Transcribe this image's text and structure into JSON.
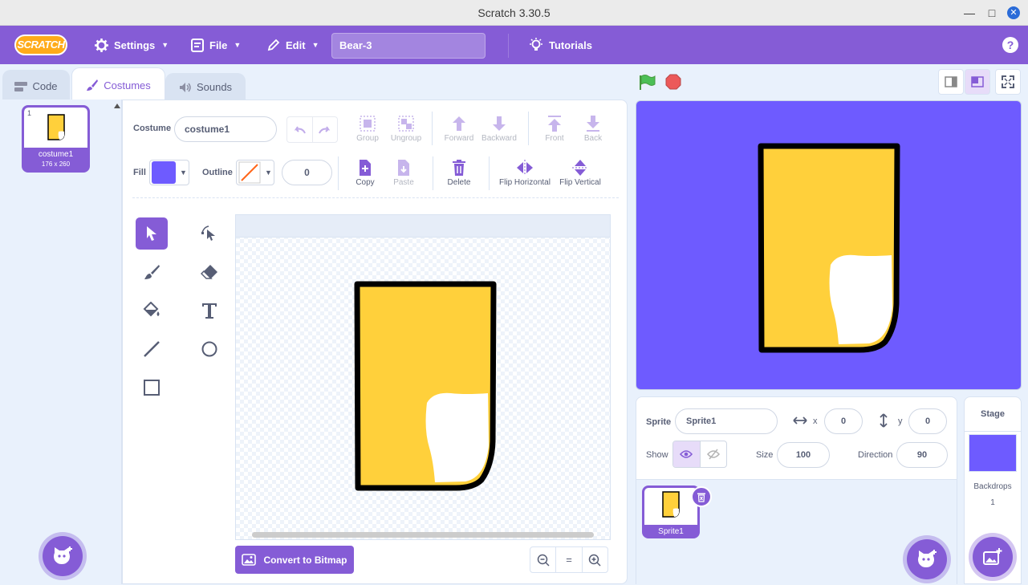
{
  "window": {
    "title": "Scratch 3.30.5"
  },
  "menubar": {
    "logo": "SCRATCH",
    "settings": "Settings",
    "file": "File",
    "edit": "Edit",
    "project_title": "Bear-3",
    "tutorials": "Tutorials",
    "help": "?"
  },
  "tabs": {
    "code": "Code",
    "costumes": "Costumes",
    "sounds": "Sounds"
  },
  "costume_list": [
    {
      "index": "1",
      "name": "costume1",
      "size": "176 x 260"
    }
  ],
  "editor": {
    "costume_label": "Costume",
    "costume_name": "costume1",
    "fill_label": "Fill",
    "fill_color": "#6e5bff",
    "outline_label": "Outline",
    "outline_width": "0",
    "toolbar": {
      "group": "Group",
      "ungroup": "Ungroup",
      "forward": "Forward",
      "backward": "Backward",
      "front": "Front",
      "back": "Back",
      "copy": "Copy",
      "paste": "Paste",
      "delete": "Delete",
      "flip_h": "Flip Horizontal",
      "flip_v": "Flip Vertical"
    },
    "convert_button": "Convert to Bitmap",
    "zoom_reset": "="
  },
  "sprite_info": {
    "sprite_label": "Sprite",
    "sprite_name": "Sprite1",
    "x_label": "x",
    "x_value": "0",
    "y_label": "y",
    "y_value": "0",
    "show_label": "Show",
    "size_label": "Size",
    "size_value": "100",
    "direction_label": "Direction",
    "direction_value": "90"
  },
  "sprites": [
    {
      "name": "Sprite1"
    }
  ],
  "stage_panel": {
    "title": "Stage",
    "backdrops_label": "Backdrops",
    "backdrops_count": "1"
  },
  "colors": {
    "accent": "#855cd6",
    "stage_bg": "#6e5bff",
    "bear_fill": "#ffd03b"
  }
}
